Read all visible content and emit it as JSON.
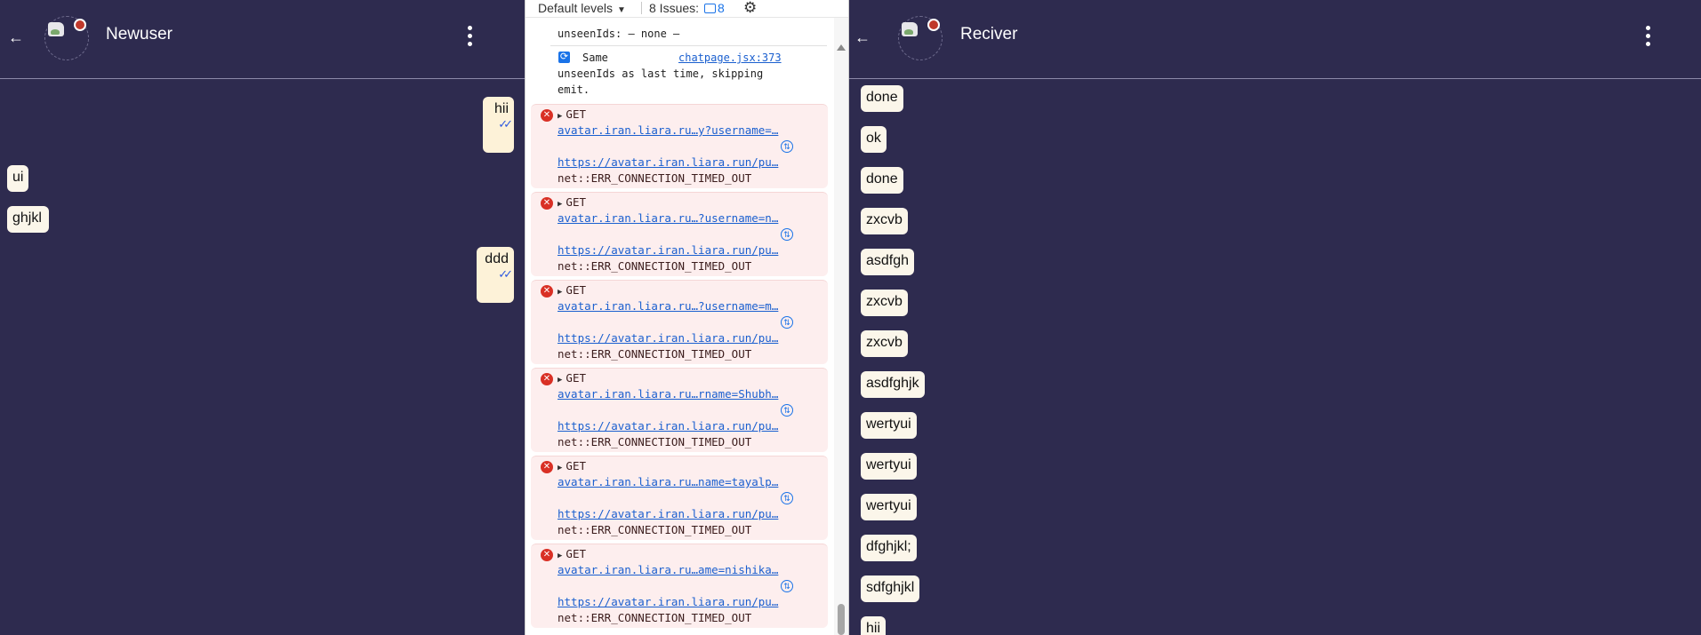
{
  "left_chat": {
    "title": "Newuser",
    "back_icon": "back-arrow-icon",
    "messages": [
      {
        "text": "hii",
        "direction": "sent",
        "ticks": "✓✓"
      },
      {
        "text": "ui",
        "direction": "received"
      },
      {
        "text": "ghjkl",
        "direction": "received"
      },
      {
        "text": "ddd",
        "direction": "sent",
        "ticks": "✓✓"
      }
    ]
  },
  "right_chat": {
    "title": "Reciver",
    "messages": [
      "done",
      "ok",
      "done",
      "zxcvb",
      "asdfgh",
      "zxcvb",
      "zxcvb",
      "asdfghjk",
      "wertyui",
      "wertyui",
      "wertyui",
      "dfghjkl;",
      "sdfghjkl",
      "hii"
    ]
  },
  "devtools": {
    "levels_label": "Default levels",
    "issues_label": "8 Issues:",
    "issues_count": "8",
    "top_line": "unseenIds: — none —",
    "same_label": "Same",
    "same_source": "chatpage.jsx:373",
    "same_line1": "unseenIds as last time, skipping",
    "same_line2": "emit.",
    "errors": [
      {
        "method": "GET",
        "short_url": "avatar.iran.liara.ru…y?username=…",
        "full_url": "https://avatar.iran.liara.run/pu…",
        "status": "net::ERR_CONNECTION_TIMED_OUT"
      },
      {
        "method": "GET",
        "short_url": "avatar.iran.liara.ru…?username=n…",
        "full_url": "https://avatar.iran.liara.run/pu…",
        "status": "net::ERR_CONNECTION_TIMED_OUT"
      },
      {
        "method": "GET",
        "short_url": "avatar.iran.liara.ru…?username=m…",
        "full_url": "https://avatar.iran.liara.run/pu…",
        "status": "net::ERR_CONNECTION_TIMED_OUT"
      },
      {
        "method": "GET",
        "short_url": "avatar.iran.liara.ru…rname=Shubh…",
        "full_url": "https://avatar.iran.liara.run/pu…",
        "status": "net::ERR_CONNECTION_TIMED_OUT"
      },
      {
        "method": "GET",
        "short_url": "avatar.iran.liara.ru…name=tayalp…",
        "full_url": "https://avatar.iran.liara.run/pu…",
        "status": "net::ERR_CONNECTION_TIMED_OUT"
      },
      {
        "method": "GET",
        "short_url": "avatar.iran.liara.ru…ame=nishika…",
        "full_url": "https://avatar.iran.liara.run/pu…",
        "status": "net::ERR_CONNECTION_TIMED_OUT"
      }
    ]
  },
  "colors": {
    "chat_background": "#2e2b4f",
    "bubble": "#fbf6ea",
    "error_background": "#fdeeee",
    "link": "#1a5fcf"
  }
}
